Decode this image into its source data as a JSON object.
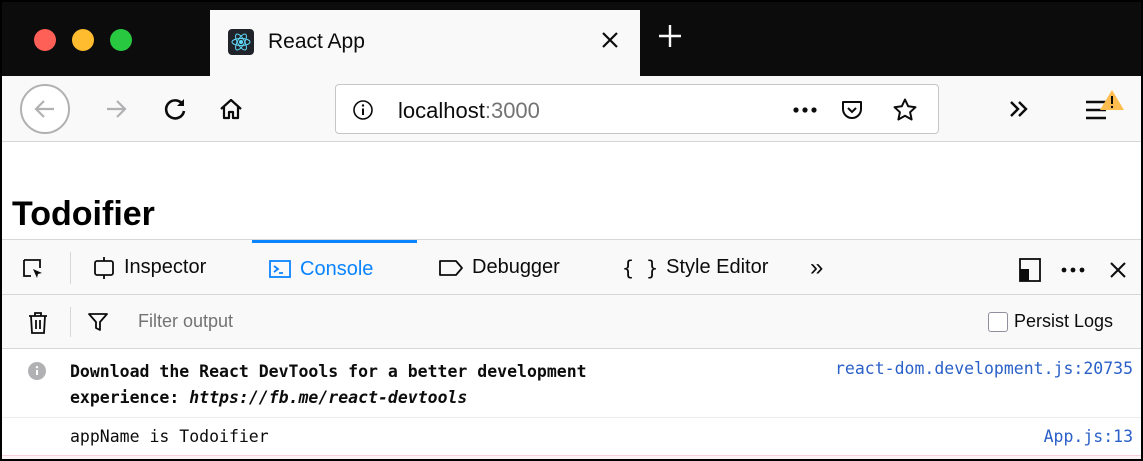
{
  "window": {
    "tab_title": "React App",
    "new_tab_icon": "plus-icon",
    "traffic_colors": {
      "close": "#fe5f57",
      "minimize": "#febc2e",
      "maximize": "#28c840"
    }
  },
  "navbar": {
    "url_host": "localhost",
    "url_port": ":3000",
    "page_actions_icon": "ellipsis-icon",
    "pocket_icon": "pocket-icon",
    "bookmark_icon": "star-icon",
    "overflow_icon": "double-chevron-icon",
    "menu_icon": "hamburger-icon"
  },
  "page": {
    "title": "Todoifier"
  },
  "devtools": {
    "tabs": [
      {
        "label": "Inspector",
        "icon": "inspector-icon"
      },
      {
        "label": "Console",
        "icon": "console-icon",
        "active": true
      },
      {
        "label": "Debugger",
        "icon": "debugger-icon"
      },
      {
        "label": "Style Editor",
        "icon": "braces-icon"
      }
    ],
    "more_tabs_label": "»",
    "accent_color": "#0a84ff"
  },
  "console": {
    "filter_placeholder": "Filter output",
    "persist_logs_label": "Persist Logs",
    "messages": [
      {
        "level": "info",
        "text_line1": "Download the React DevTools for a better development",
        "text_line2_prefix": "experience: ",
        "text_line2_url": "https://fb.me/react-devtools",
        "source": "react-dom.development.js:20735"
      },
      {
        "level": "log",
        "text": "appName is Todoifier",
        "source": "App.js:13"
      }
    ]
  }
}
